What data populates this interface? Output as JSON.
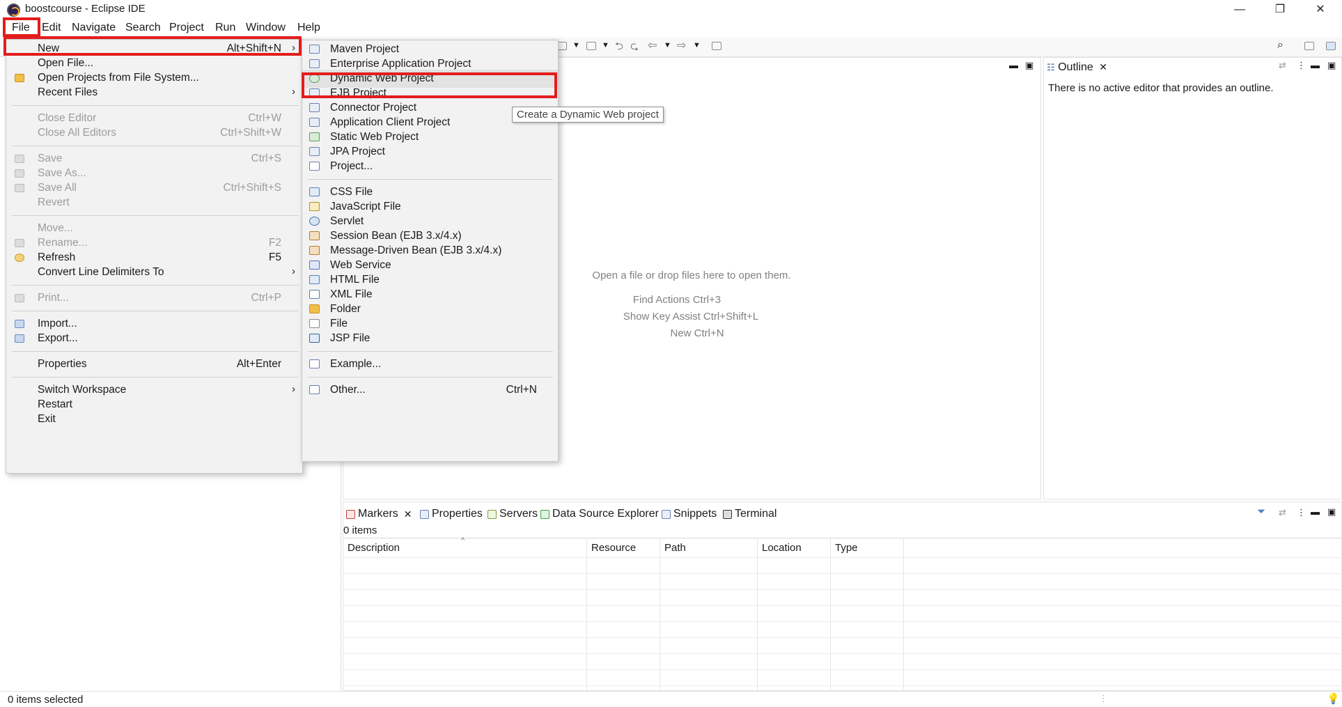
{
  "window": {
    "title": "boostcourse - Eclipse IDE",
    "minimize": "—",
    "restore": "❐",
    "close": "✕"
  },
  "menubar": [
    "File",
    "Edit",
    "Navigate",
    "Search",
    "Project",
    "Run",
    "Window",
    "Help"
  ],
  "file_menu": {
    "items": [
      {
        "label": "New",
        "accel": "Alt+Shift+N",
        "arrow": "›",
        "disabled": false
      },
      {
        "label": "Open File...",
        "accel": "",
        "disabled": false
      },
      {
        "label": "Open Projects from File System...",
        "accel": "",
        "disabled": false
      },
      {
        "label": "Recent Files",
        "accel": "",
        "arrow": "›",
        "disabled": false
      },
      {
        "label": "Close Editor",
        "accel": "Ctrl+W",
        "disabled": true
      },
      {
        "label": "Close All Editors",
        "accel": "Ctrl+Shift+W",
        "disabled": true
      },
      {
        "label": "Save",
        "accel": "Ctrl+S",
        "disabled": true
      },
      {
        "label": "Save As...",
        "accel": "",
        "disabled": true
      },
      {
        "label": "Save All",
        "accel": "Ctrl+Shift+S",
        "disabled": true
      },
      {
        "label": "Revert",
        "accel": "",
        "disabled": true
      },
      {
        "label": "Move...",
        "accel": "",
        "disabled": true
      },
      {
        "label": "Rename...",
        "accel": "F2",
        "disabled": true
      },
      {
        "label": "Refresh",
        "accel": "F5",
        "disabled": false
      },
      {
        "label": "Convert Line Delimiters To",
        "accel": "",
        "arrow": "›",
        "disabled": false
      },
      {
        "label": "Print...",
        "accel": "Ctrl+P",
        "disabled": true
      },
      {
        "label": "Import...",
        "accel": "",
        "disabled": false
      },
      {
        "label": "Export...",
        "accel": "",
        "disabled": false
      },
      {
        "label": "Properties",
        "accel": "Alt+Enter",
        "disabled": false
      },
      {
        "label": "Switch Workspace",
        "accel": "",
        "arrow": "›",
        "disabled": false
      },
      {
        "label": "Restart",
        "accel": "",
        "disabled": false
      },
      {
        "label": "Exit",
        "accel": "",
        "disabled": false
      }
    ]
  },
  "new_menu": {
    "items": [
      {
        "label": "Maven Project",
        "accel": ""
      },
      {
        "label": "Enterprise Application Project",
        "accel": ""
      },
      {
        "label": "Dynamic Web Project",
        "accel": ""
      },
      {
        "label": "EJB Project",
        "accel": ""
      },
      {
        "label": "Connector Project",
        "accel": ""
      },
      {
        "label": "Application Client Project",
        "accel": ""
      },
      {
        "label": "Static Web Project",
        "accel": ""
      },
      {
        "label": "JPA Project",
        "accel": ""
      },
      {
        "label": "Project...",
        "accel": ""
      },
      {
        "label": "CSS File",
        "accel": ""
      },
      {
        "label": "JavaScript File",
        "accel": ""
      },
      {
        "label": "Servlet",
        "accel": ""
      },
      {
        "label": "Session Bean (EJB 3.x/4.x)",
        "accel": ""
      },
      {
        "label": "Message-Driven Bean (EJB 3.x/4.x)",
        "accel": ""
      },
      {
        "label": "Web Service",
        "accel": ""
      },
      {
        "label": "HTML File",
        "accel": ""
      },
      {
        "label": "XML File",
        "accel": ""
      },
      {
        "label": "Folder",
        "accel": ""
      },
      {
        "label": "File",
        "accel": ""
      },
      {
        "label": "JSP File",
        "accel": ""
      },
      {
        "label": "Example...",
        "accel": ""
      },
      {
        "label": "Other...",
        "accel": "Ctrl+N"
      }
    ]
  },
  "tooltip": "Create a Dynamic Web project",
  "editor": {
    "hint": "Open a file or drop files here to open them.",
    "find_actions": "Find Actions Ctrl+3",
    "key_assist": "Show Key Assist Ctrl+Shift+L",
    "new": "New Ctrl+N"
  },
  "outline": {
    "tab": "Outline",
    "message": "There is no active editor that provides an outline."
  },
  "bottom_tabs": [
    "Markers",
    "Properties",
    "Servers",
    "Data Source Explorer",
    "Snippets",
    "Terminal"
  ],
  "markers": {
    "count": "0 items",
    "columns": [
      "Description",
      "Resource",
      "Path",
      "Location",
      "Type"
    ]
  },
  "status": "0 items selected",
  "colors": {
    "highlight": "#e31d1d",
    "menu_bg": "#f2f2f2",
    "disabled_text": "#9c9c9c"
  }
}
